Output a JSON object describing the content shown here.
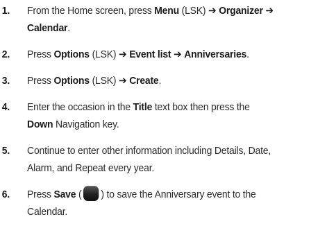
{
  "steps": [
    {
      "number": "1.",
      "lines": [
        [
          {
            "t": "From the Home screen, press "
          },
          {
            "t": "Menu",
            "b": true
          },
          {
            "t": " (LSK) "
          },
          {
            "t": "➔",
            "b": true
          },
          {
            "t": " "
          },
          {
            "t": "Organizer",
            "b": true
          },
          {
            "t": " "
          },
          {
            "t": "➔",
            "b": true
          }
        ],
        [
          {
            "t": "Calendar",
            "b": true
          },
          {
            "t": "."
          }
        ]
      ]
    },
    {
      "number": "2.",
      "lines": [
        [
          {
            "t": "Press "
          },
          {
            "t": "Options",
            "b": true
          },
          {
            "t": " (LSK) "
          },
          {
            "t": "➔",
            "b": true
          },
          {
            "t": " "
          },
          {
            "t": "Event list",
            "b": true
          },
          {
            "t": " "
          },
          {
            "t": "➔",
            "b": true
          },
          {
            "t": " "
          },
          {
            "t": "Anniversaries",
            "b": true
          },
          {
            "t": "."
          }
        ]
      ]
    },
    {
      "number": "3.",
      "lines": [
        [
          {
            "t": "Press "
          },
          {
            "t": "Options",
            "b": true
          },
          {
            "t": " (LSK) "
          },
          {
            "t": "➔",
            "b": true
          },
          {
            "t": " "
          },
          {
            "t": "Create",
            "b": true
          },
          {
            "t": "."
          }
        ]
      ]
    },
    {
      "number": "4.",
      "lines": [
        [
          {
            "t": "Enter the occasion in the "
          },
          {
            "t": "Title",
            "b": true
          },
          {
            "t": " text box then press the"
          }
        ],
        [
          {
            "t": "Down",
            "b": true
          },
          {
            "t": " Navigation key."
          }
        ]
      ]
    },
    {
      "number": "5.",
      "lines": [
        [
          {
            "t": "Continue to enter other information including Details, Date,"
          }
        ],
        [
          {
            "t": "Alarm, and Repeat every year."
          }
        ]
      ]
    },
    {
      "number": "6.",
      "lines": [
        [
          {
            "t": "Press "
          },
          {
            "t": "Save",
            "b": true
          },
          {
            "t": " ("
          },
          {
            "icon": "save-key-icon"
          },
          {
            "t": ") to save the Anniversary event to the"
          }
        ],
        [
          {
            "t": "Calendar."
          }
        ]
      ]
    }
  ]
}
